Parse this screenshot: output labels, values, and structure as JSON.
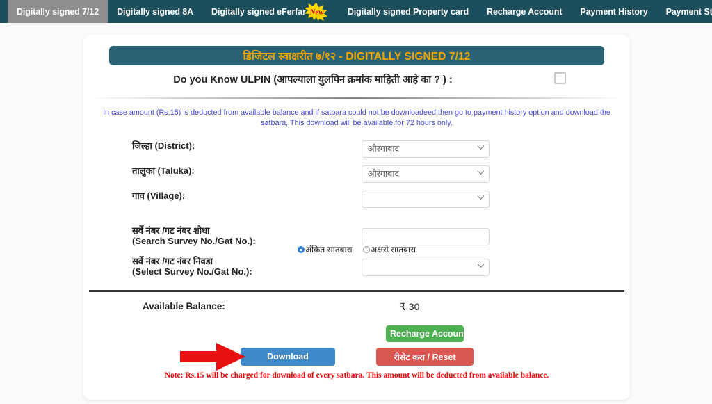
{
  "navbar": {
    "items": [
      {
        "label": "Digitally signed 7/12",
        "active": true,
        "badge": null
      },
      {
        "label": "Digitally signed 8A",
        "active": false,
        "badge": null
      },
      {
        "label": "Digitally signed eFerfar",
        "active": false,
        "badge": "New"
      },
      {
        "label": "Digitally signed Property card",
        "active": false,
        "badge": null
      },
      {
        "label": "Recharge Account",
        "active": false,
        "badge": null
      },
      {
        "label": "Payment History",
        "active": false,
        "badge": null
      },
      {
        "label": "Payment Status",
        "active": false,
        "badge": null
      }
    ],
    "background_color": "#1d4e5c",
    "active_tab_color": "#8e8e8e"
  },
  "card": {
    "banner_title": "डिजिटल स्वाक्षरीत ७/१२ - DIGITALLY SIGNED 7/12",
    "banner_bg_color": "#2a6275",
    "banner_text_color": "#f0a500",
    "ulpin": {
      "label": "Do you Know ULPIN (आपल्याला युलपिन क्रमांक माहिती आहे का ? ) :",
      "checked": false
    },
    "notice": "In case amount (Rs.15) is deducted from available balance and if satbara could not be downloadeed then go to payment history option and download the satbara, This download will be available for 72 hours only.",
    "notice_color": "#4444dd",
    "form": {
      "district": {
        "label": "जिल्हा (District):",
        "value": "औरंगाबाद",
        "type": "select"
      },
      "taluka": {
        "label": "तालुका (Taluka):",
        "value": "औरंगाबाद",
        "type": "select"
      },
      "village": {
        "label": "गाव (Village):",
        "value": "",
        "type": "select"
      },
      "satbara_type": {
        "options": [
          {
            "label": "अंकित सातबारा",
            "selected": true
          },
          {
            "label": "अक्षरी सातबारा",
            "selected": false
          }
        ]
      },
      "search_survey": {
        "label_mr": "सर्वे नंबर /गट नंबर शोधा",
        "label_en": "(Search Survey No./Gat No.):",
        "value": "",
        "type": "text"
      },
      "select_survey": {
        "label_mr": "सर्वे नंबर /गट नंबर निवडा",
        "label_en": "(Select Survey No./Gat No.):",
        "value": "",
        "type": "select"
      }
    },
    "balance": {
      "label": "Available Balance:",
      "value": "₹ 30"
    },
    "buttons": {
      "recharge": {
        "label": "Recharge Account",
        "color": "#4cb051"
      },
      "download": {
        "label": "Download",
        "color": "#4089c9"
      },
      "reset": {
        "label": "रीसेट करा / Reset",
        "color": "#d95750"
      }
    },
    "footer_note": "Note: Rs.15 will be charged for download of every satbara. This amount will be deducted from available balance.",
    "footer_note_color": "#ff0000"
  },
  "annotation": {
    "arrow_color": "#e8110f",
    "points_to": "Download"
  }
}
